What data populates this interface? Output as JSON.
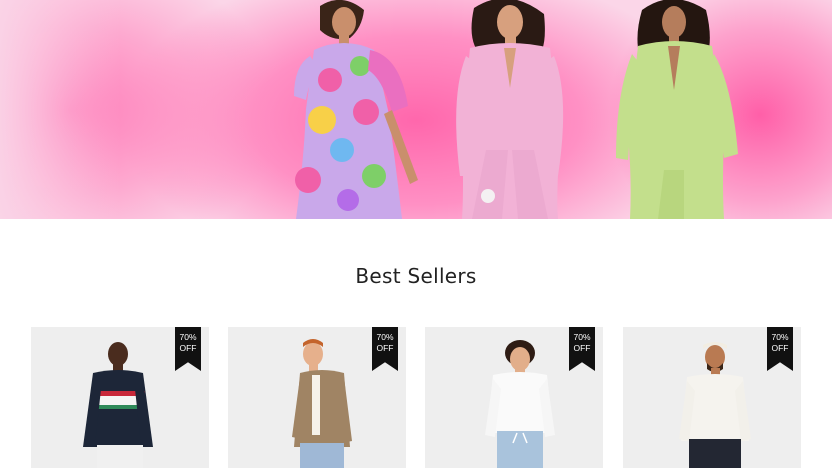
{
  "hero": {
    "alt": "Three models in colorful suits and a floral dress on a pink background"
  },
  "section": {
    "title": "Best Sellers"
  },
  "products": [
    {
      "badge_pct": "70%",
      "badge_off": "OFF"
    },
    {
      "badge_pct": "70%",
      "badge_off": "OFF"
    },
    {
      "badge_pct": "70%",
      "badge_off": "OFF"
    },
    {
      "badge_pct": "70%",
      "badge_off": "OFF"
    }
  ],
  "colors": {
    "hero_pink": "#ff67ac",
    "badge_bg": "#111111",
    "card_bg": "#eeeeee"
  }
}
